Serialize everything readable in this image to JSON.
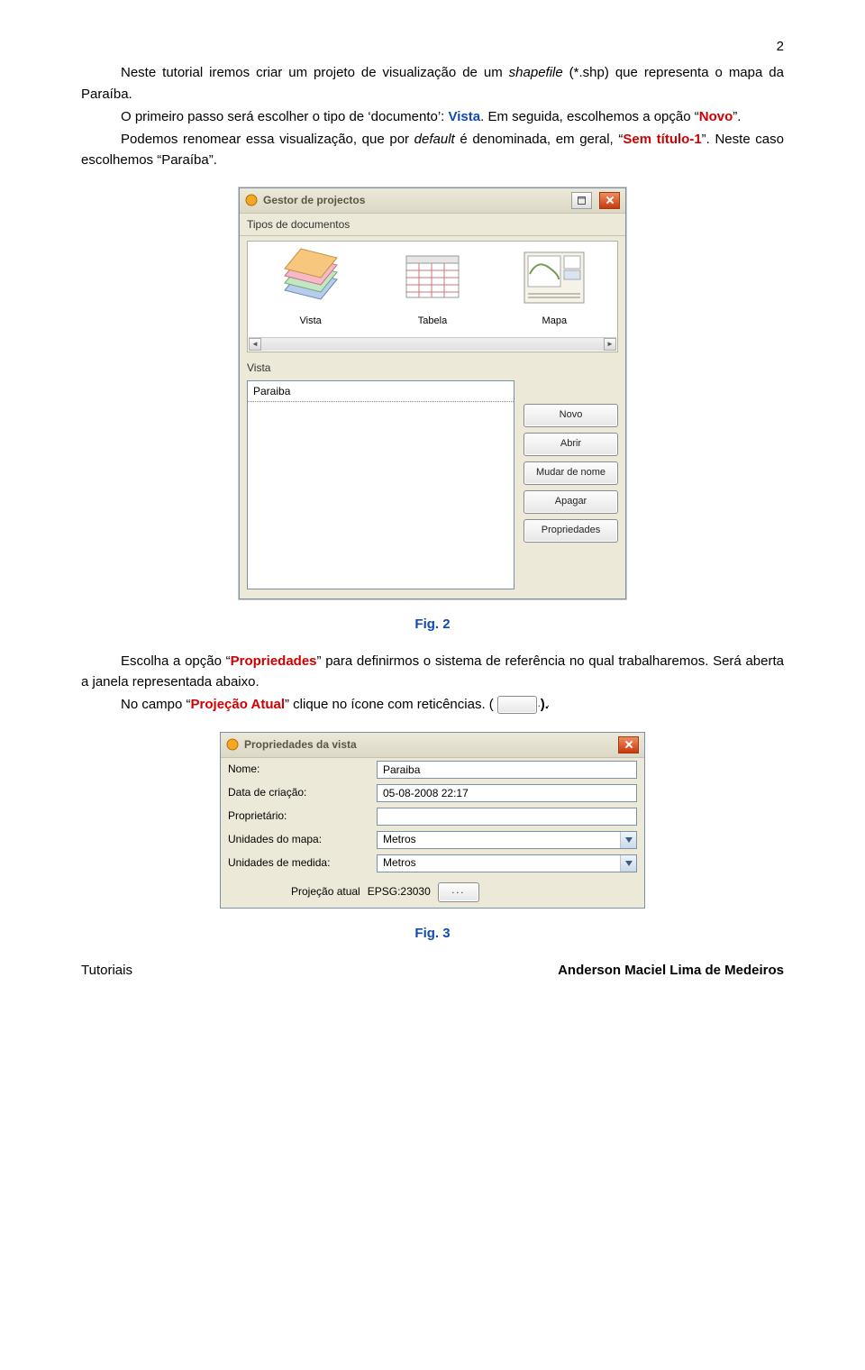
{
  "page_number": "2",
  "para1_a": "Neste tutorial iremos criar um projeto de visualização de um ",
  "para1_b_italic": "shapefile",
  "para1_c": " (*.shp) que representa o mapa da Paraíba.",
  "para2_a": "O primeiro passo será escolher o tipo de ‘documento’: ",
  "para2_b_blue": "Vista",
  "para2_c": ". Em seguida, escolhemos a opção “",
  "para2_d_red": "Novo",
  "para2_e": "”.",
  "para3_a": "Podemos renomear essa visualização, que por ",
  "para3_b_italic": "default",
  "para3_c": " é denominada, em geral, “",
  "para3_d_red": "Sem título-1",
  "para3_e": "”. Neste caso escolhemos “Paraíba”.",
  "gp": {
    "title": "Gestor de projectos",
    "section": "Tipos de documentos",
    "types": [
      "Vista",
      "Tabela",
      "Mapa"
    ],
    "vista_label": "Vista",
    "list_item": "Paraiba",
    "buttons": [
      "Novo",
      "Abrir",
      "Mudar de nome",
      "Apagar",
      "Propriedades"
    ]
  },
  "fig2": "Fig. 2",
  "para4_a": "Escolha a opção “",
  "para4_b_red": "Propriedades",
  "para4_c": "” para definirmos o sistema de referência no qual trabalharemos. Será aberta a janela representada abaixo.",
  "para5_a": "No campo “",
  "para5_b_red": "Projeção Atual",
  "para5_c": "” clique no ícone com reticências. (",
  "para5_d": ").",
  "ellipsis": "...",
  "pv": {
    "title": "Propriedades da vista",
    "labels": {
      "nome": "Nome:",
      "data": "Data de criação:",
      "prop": "Proprietário:",
      "umapa": "Unidades do mapa:",
      "umed": "Unidades de medida:",
      "proj": "Projeção atual"
    },
    "values": {
      "nome": "Paraiba",
      "data": "05-08-2008 22:17",
      "prop": "",
      "umapa": "Metros",
      "umed": "Metros",
      "proj": "EPSG:23030"
    }
  },
  "fig3": "Fig. 3",
  "footer_left": "Tutoriais",
  "footer_right": "Anderson Maciel Lima de Medeiros"
}
